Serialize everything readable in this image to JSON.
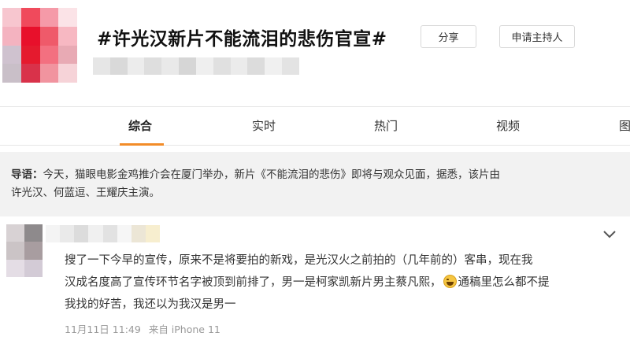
{
  "header": {
    "title": "#许光汉新片不能流泪的悲伤官宣#",
    "share_label": "分享",
    "host_label": "申请主持人"
  },
  "tabs": [
    {
      "label": "综合",
      "active": true
    },
    {
      "label": "实时",
      "active": false
    },
    {
      "label": "热门",
      "active": false
    },
    {
      "label": "视频",
      "active": false
    },
    {
      "label": "图",
      "active": false
    }
  ],
  "guide": {
    "prefix": "导语：",
    "line1": "今天，猫眼电影金鸡推介会在厦门举办，新片《不能流泪的悲伤》即将与观众见面，据悉，该片由",
    "line2": "许光汉、何蓝逗、王耀庆主演。"
  },
  "comment": {
    "line1": "搜了一下今早的宣传，原来不是将要拍的新戏，是光汉火之前拍的（几年前的）客串，现在我",
    "line2a": "汉成名度高了宣传环节名字被顶到前排了，男一是柯家凯新片男主蔡凡熙，",
    "line2b": "通稿里怎么都不提",
    "line3": "我找的好苦，我还以为我汉是男一",
    "date": "11月11日 11:49",
    "source": "来自 iPhone 11"
  },
  "icons": {
    "chevron": "chevron-down-icon",
    "emoji": "grin-sweat-emoji-icon"
  },
  "colors": {
    "tab_active_underline": "#f28c28",
    "guide_background": "#f2f2f2",
    "meta_text": "#999999"
  }
}
